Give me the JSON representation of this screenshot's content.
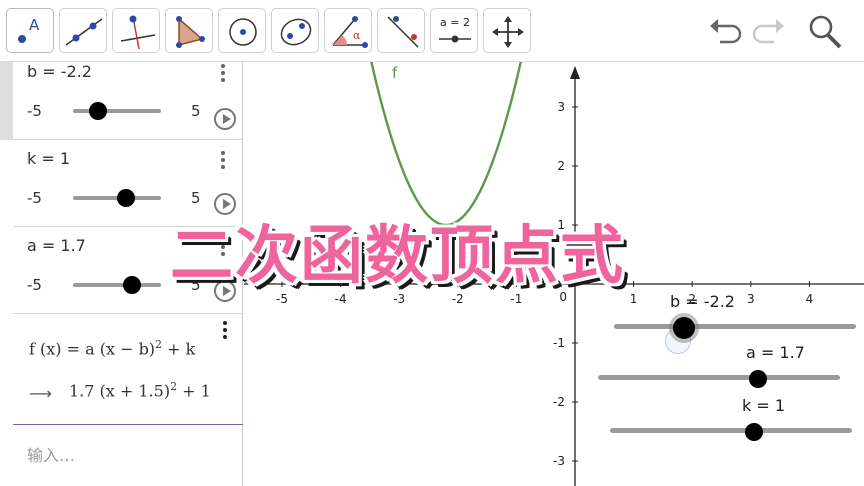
{
  "toolbar": {
    "tools": [
      {
        "name": "move-tool",
        "icon": "point-a-icon",
        "label": "A"
      },
      {
        "name": "line-tool",
        "icon": "line-icon"
      },
      {
        "name": "perpendicular-line-tool",
        "icon": "perpendicular-line-icon"
      },
      {
        "name": "polygon-tool",
        "icon": "polygon-icon"
      },
      {
        "name": "circle-center-tool",
        "icon": "circle-center-icon"
      },
      {
        "name": "ellipse-tool",
        "icon": "ellipse-icon"
      },
      {
        "name": "angle-tool",
        "icon": "angle-icon",
        "label": "α"
      },
      {
        "name": "reflect-tool",
        "icon": "reflect-line-icon"
      },
      {
        "name": "slider-tool",
        "icon": "slider-icon",
        "label": "a = 2"
      },
      {
        "name": "move-graphics-tool",
        "icon": "move-arrows-icon"
      }
    ],
    "undo_icon": "undo-icon",
    "redo_icon": "redo-icon",
    "search_icon": "search-icon"
  },
  "algebra": {
    "items": [
      {
        "name_text": "b = -2.2",
        "min": "-5",
        "max": "5",
        "value": -2.2
      },
      {
        "name_text": "k = 1",
        "min": "-5",
        "max": "5",
        "value": 1
      },
      {
        "name_text": "a = 1.7",
        "min": "-5",
        "max": "5",
        "value": 1.7
      }
    ],
    "function": {
      "definition_prefix": "f (x) = a  (x − b)",
      "definition_exp": "2",
      "definition_suffix": " + k",
      "result_arrow": "⟶",
      "result_prefix": "1.7  (x + 1.5)",
      "result_exp": "2",
      "result_suffix": " + 1"
    },
    "input_placeholder": "输入…"
  },
  "graphics": {
    "function_label": "f",
    "x_ticks": [
      "-5",
      "-4",
      "-3",
      "-2",
      "-1",
      "1",
      "2",
      "3",
      "4"
    ],
    "y_ticks": [
      "3",
      "2",
      "1",
      "-1",
      "-2",
      "-3"
    ],
    "origin_label": "0",
    "sliders": [
      {
        "label": "b = -2.2",
        "value": -2.2
      },
      {
        "label": "a = 1.7",
        "value": 1.7
      },
      {
        "label": "k = 1",
        "value": 1
      }
    ],
    "curve_color": "#5a9a4a"
  },
  "overlay_title": "二次函数顶点式",
  "colors": {
    "title_pink": "#f0649e",
    "input_border": "#7a5fb0"
  }
}
